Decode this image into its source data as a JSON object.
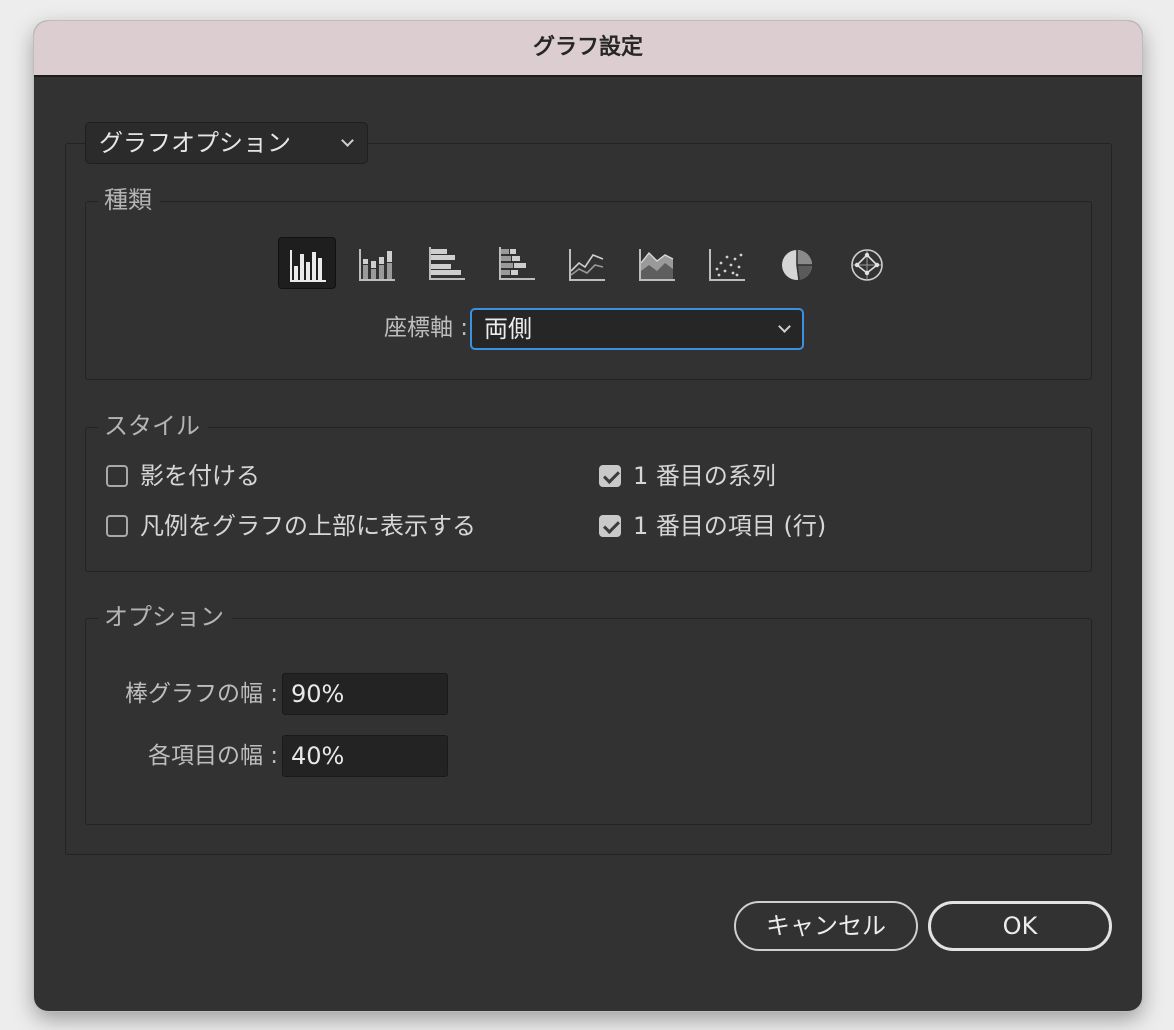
{
  "dialog": {
    "title": "グラフ設定"
  },
  "panel_selector": {
    "value": "グラフオプション"
  },
  "type_section": {
    "legend": "種類",
    "icons": [
      {
        "name": "grouped-column-graph-icon",
        "selected": true
      },
      {
        "name": "stacked-column-graph-icon",
        "selected": false
      },
      {
        "name": "grouped-bar-graph-icon",
        "selected": false
      },
      {
        "name": "stacked-bar-graph-icon",
        "selected": false
      },
      {
        "name": "line-graph-icon",
        "selected": false
      },
      {
        "name": "area-graph-icon",
        "selected": false
      },
      {
        "name": "scatter-graph-icon",
        "selected": false
      },
      {
        "name": "pie-graph-icon",
        "selected": false
      },
      {
        "name": "radar-graph-icon",
        "selected": false
      }
    ],
    "axis_label": "座標軸 :",
    "axis_value": "両側"
  },
  "style_section": {
    "legend": "スタイル",
    "add_shadow": {
      "label": "影を付ける",
      "checked": false
    },
    "legend_on_top": {
      "label": "凡例をグラフの上部に表示する",
      "checked": false
    },
    "first_series": {
      "label": "1 番目の系列",
      "checked": true
    },
    "first_item": {
      "label": "1 番目の項目 (行)",
      "checked": true
    }
  },
  "options_section": {
    "legend": "オプション",
    "bar_width_label": "棒グラフの幅 :",
    "bar_width_value": "90%",
    "item_width_label": "各項目の幅 :",
    "item_width_value": "40%"
  },
  "buttons": {
    "cancel": "キャンセル",
    "ok": "OK"
  },
  "colors": {
    "accent": "#3d8fe0",
    "window_bg": "#323232",
    "titlebar_bg": "#dccdd0"
  }
}
